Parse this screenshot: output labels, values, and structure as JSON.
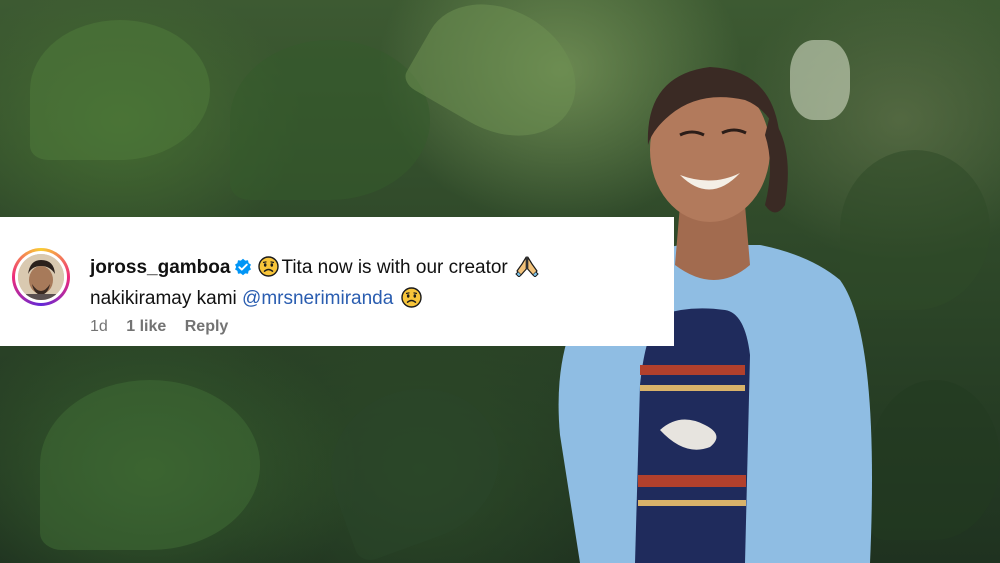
{
  "comment": {
    "username": "joross_gamboa",
    "text_part1": "Tita now is with our creator",
    "text_line2": "nakikiramay kami",
    "mention": "@mrsnerimiranda",
    "time": "1d",
    "likes": "1 like",
    "reply_label": "Reply"
  },
  "colors": {
    "card_bg": "#ffffff",
    "mention": "#2a5db0",
    "verified": "#0095f6",
    "meta": "#737373",
    "cardigan": "#8fbde3"
  },
  "icons": [
    "verified-badge-icon",
    "sad-face-emoji",
    "praying-hands-emoji"
  ]
}
